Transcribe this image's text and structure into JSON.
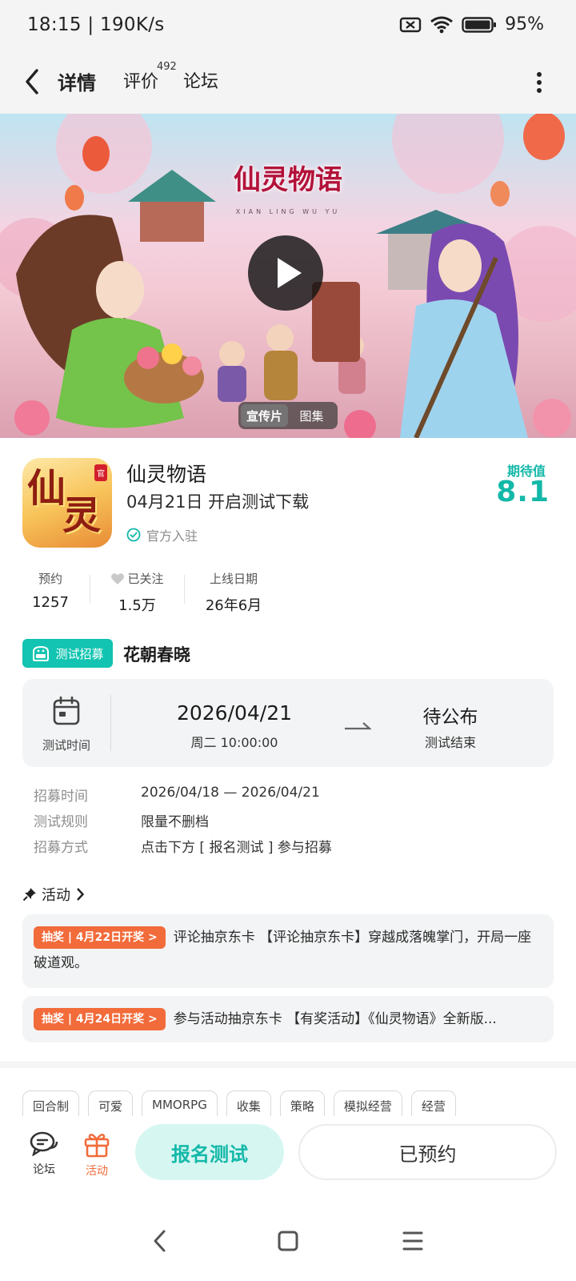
{
  "status_bar": {
    "time": "18:15 | 190K/s",
    "battery": "95%"
  },
  "header": {
    "tabs": [
      {
        "label": "详情",
        "active": true
      },
      {
        "label": "评价",
        "count": "492"
      },
      {
        "label": "论坛"
      }
    ]
  },
  "banner": {
    "logo_text": "仙灵物语",
    "logo_sub": "XIAN LING WU YU",
    "media_tabs": [
      "宣传片",
      "图集"
    ],
    "active_media_tab": "宣传片"
  },
  "game": {
    "icon_text": [
      "仙",
      "灵"
    ],
    "icon_badge": "官",
    "name": "仙灵物语",
    "release_note": "04月21日 开启测试下载",
    "official_label": "官方入驻",
    "expect_label": "期待值",
    "expect_value": "8.1"
  },
  "stats": [
    {
      "label": "预约",
      "value": "1257"
    },
    {
      "label": "已关注",
      "value": "1.5万"
    },
    {
      "label": "上线日期",
      "value": "26年6月"
    }
  ],
  "test": {
    "badge": "测试招募",
    "name": "花朝春晓",
    "time_label": "测试时间",
    "start_date": "2026/04/21",
    "start_time": "周二  10:00:00",
    "end_value": "待公布",
    "end_label": "测试结束",
    "info": [
      {
        "key": "招募时间",
        "value": "2026/04/18 — 2026/04/21"
      },
      {
        "key": "测试规则",
        "value": "限量不删档"
      },
      {
        "key": "招募方式",
        "value": "点击下方 [ 报名测试 ] 参与招募"
      }
    ]
  },
  "activities": {
    "title": "活动",
    "items": [
      {
        "tag": "抽奖 | 4月22日开奖 >",
        "text": "评论抽京东卡 【评论抽京东卡】穿越成落魄掌门，开局一座破道观。"
      },
      {
        "tag": "抽奖 | 4月24日开奖 >",
        "text": "参与活动抽京东卡 【有奖活动】《仙灵物语》全新版..."
      }
    ]
  },
  "tags": [
    "回合制",
    "可爱",
    "MMORPG",
    "收集",
    "策略",
    "模拟经营",
    "经营"
  ],
  "bottom_bar": {
    "forum_label": "论坛",
    "activity_label": "活动",
    "signup_label": "报名测试",
    "reserved_label": "已预约"
  },
  "colors": {
    "accent": "#13b8a8",
    "lottery": "#f26b3a"
  }
}
